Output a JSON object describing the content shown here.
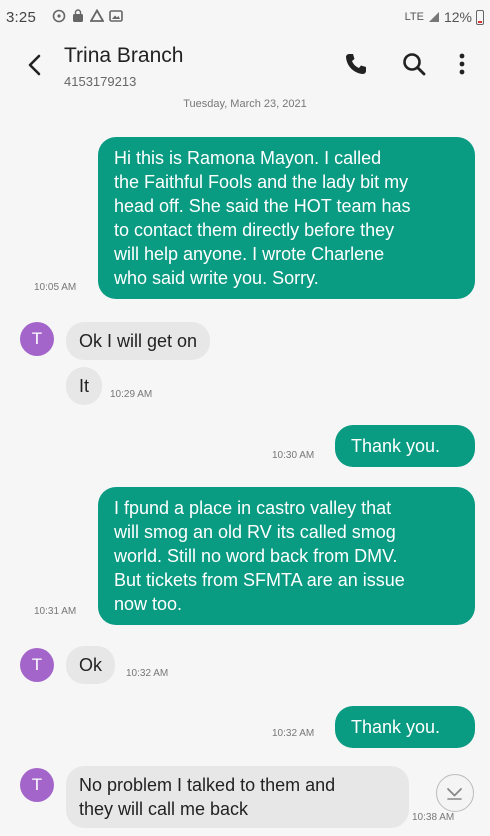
{
  "status_bar": {
    "time": "3:25",
    "network": "LTE",
    "battery": "12%",
    "icons": [
      "whatsapp-icon",
      "bag-icon",
      "drive-icon",
      "gallery-icon"
    ]
  },
  "header": {
    "contact_name": "Trina Branch",
    "contact_number": "4153179213",
    "icons": [
      "back-arrow-icon",
      "phone-icon",
      "search-icon",
      "more-vertical-icon"
    ]
  },
  "date_separator": "Tuesday, March 23, 2021",
  "messages": [
    {
      "direction": "outgoing",
      "text": "Hi this is Ramona Mayon. I called the Faithful Fools and the lady bit my head off. She said the HOT team has to contact them directly before they will help anyone. I wrote Charlene who said write you. Sorry.",
      "lines": [
        "Hi this is Ramona Mayon.  I called",
        "the Faithful Fools and the lady bit my",
        "head off.  She said the HOT team has",
        "to contact them directly before they",
        "will help anyone.  I wrote Charlene",
        "who said write you.  Sorry."
      ],
      "time": "10:05 AM"
    },
    {
      "direction": "incoming",
      "avatar": "T",
      "text": "Ok I will get on"
    },
    {
      "direction": "incoming",
      "text": "It",
      "time": "10:29 AM"
    },
    {
      "direction": "outgoing",
      "text": "Thank you.",
      "time": "10:30 AM"
    },
    {
      "direction": "outgoing",
      "text": "I fpund a place in castro valley that will smog an old RV its called smog world. Still no word back from DMV. But tickets from SFMTA are an issue now too.",
      "lines": [
        "I fpund a place in castro valley that",
        "will smog an old RV its called smog",
        "world.  Still no word back from DMV.",
        "But tickets from SFMTA are an issue",
        "now too."
      ],
      "time": "10:31 AM"
    },
    {
      "direction": "incoming",
      "avatar": "T",
      "text": "Ok",
      "time": "10:32 AM"
    },
    {
      "direction": "outgoing",
      "text": "Thank you.",
      "time": "10:32 AM"
    },
    {
      "direction": "incoming",
      "avatar": "T",
      "text": "No problem I talked to them and they will call me back",
      "lines": [
        "No problem I talked to them and",
        "they will call me back"
      ],
      "time": "10:38 AM"
    }
  ],
  "colors": {
    "outgoing_bubble": "#0a9b83",
    "incoming_bubble": "#e7e7e7",
    "avatar": "#a365c9",
    "background": "#f6f6f6"
  },
  "scroll_button_icon": "chevron-down-icon"
}
